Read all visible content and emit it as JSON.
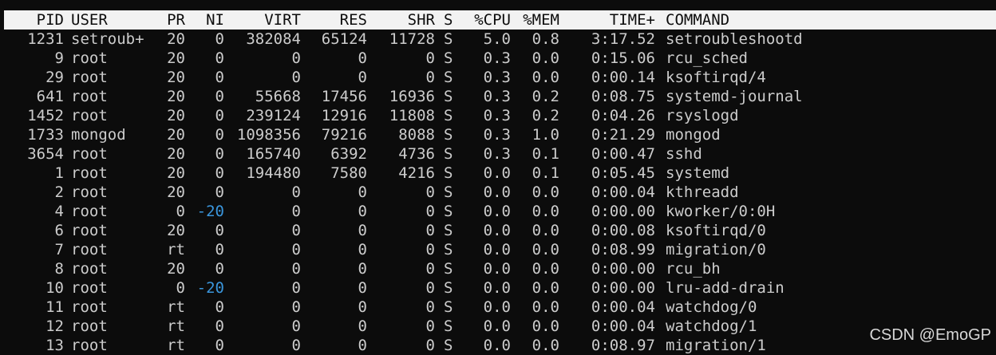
{
  "header": {
    "pid": "PID",
    "user": "USER",
    "pr": "PR",
    "ni": "NI",
    "virt": "VIRT",
    "res": "RES",
    "shr": "SHR",
    "s": "S",
    "cpu": "%CPU",
    "mem": "%MEM",
    "time": "TIME+",
    "command": "COMMAND"
  },
  "processes": [
    {
      "pid": "1231",
      "user": "setroub+",
      "pr": "20",
      "ni": "0",
      "virt": "382084",
      "res": "65124",
      "shr": "11728",
      "s": "S",
      "cpu": "5.0",
      "mem": "0.8",
      "time": "3:17.52",
      "command": "setroubleshootd"
    },
    {
      "pid": "9",
      "user": "root",
      "pr": "20",
      "ni": "0",
      "virt": "0",
      "res": "0",
      "shr": "0",
      "s": "S",
      "cpu": "0.3",
      "mem": "0.0",
      "time": "0:15.06",
      "command": "rcu_sched"
    },
    {
      "pid": "29",
      "user": "root",
      "pr": "20",
      "ni": "0",
      "virt": "0",
      "res": "0",
      "shr": "0",
      "s": "S",
      "cpu": "0.3",
      "mem": "0.0",
      "time": "0:00.14",
      "command": "ksoftirqd/4"
    },
    {
      "pid": "641",
      "user": "root",
      "pr": "20",
      "ni": "0",
      "virt": "55668",
      "res": "17456",
      "shr": "16936",
      "s": "S",
      "cpu": "0.3",
      "mem": "0.2",
      "time": "0:08.75",
      "command": "systemd-journal"
    },
    {
      "pid": "1452",
      "user": "root",
      "pr": "20",
      "ni": "0",
      "virt": "239124",
      "res": "12916",
      "shr": "11808",
      "s": "S",
      "cpu": "0.3",
      "mem": "0.2",
      "time": "0:04.26",
      "command": "rsyslogd"
    },
    {
      "pid": "1733",
      "user": "mongod",
      "pr": "20",
      "ni": "0",
      "virt": "1098356",
      "res": "79216",
      "shr": "8088",
      "s": "S",
      "cpu": "0.3",
      "mem": "1.0",
      "time": "0:21.29",
      "command": "mongod"
    },
    {
      "pid": "3654",
      "user": "root",
      "pr": "20",
      "ni": "0",
      "virt": "165740",
      "res": "6392",
      "shr": "4736",
      "s": "S",
      "cpu": "0.3",
      "mem": "0.1",
      "time": "0:00.47",
      "command": "sshd"
    },
    {
      "pid": "1",
      "user": "root",
      "pr": "20",
      "ni": "0",
      "virt": "194480",
      "res": "7580",
      "shr": "4216",
      "s": "S",
      "cpu": "0.0",
      "mem": "0.1",
      "time": "0:05.45",
      "command": "systemd"
    },
    {
      "pid": "2",
      "user": "root",
      "pr": "20",
      "ni": "0",
      "virt": "0",
      "res": "0",
      "shr": "0",
      "s": "S",
      "cpu": "0.0",
      "mem": "0.0",
      "time": "0:00.04",
      "command": "kthreadd"
    },
    {
      "pid": "4",
      "user": "root",
      "pr": "0",
      "ni": "-20",
      "virt": "0",
      "res": "0",
      "shr": "0",
      "s": "S",
      "cpu": "0.0",
      "mem": "0.0",
      "time": "0:00.00",
      "command": "kworker/0:0H"
    },
    {
      "pid": "6",
      "user": "root",
      "pr": "20",
      "ni": "0",
      "virt": "0",
      "res": "0",
      "shr": "0",
      "s": "S",
      "cpu": "0.0",
      "mem": "0.0",
      "time": "0:00.08",
      "command": "ksoftirqd/0"
    },
    {
      "pid": "7",
      "user": "root",
      "pr": "rt",
      "ni": "0",
      "virt": "0",
      "res": "0",
      "shr": "0",
      "s": "S",
      "cpu": "0.0",
      "mem": "0.0",
      "time": "0:08.99",
      "command": "migration/0"
    },
    {
      "pid": "8",
      "user": "root",
      "pr": "20",
      "ni": "0",
      "virt": "0",
      "res": "0",
      "shr": "0",
      "s": "S",
      "cpu": "0.0",
      "mem": "0.0",
      "time": "0:00.00",
      "command": "rcu_bh"
    },
    {
      "pid": "10",
      "user": "root",
      "pr": "0",
      "ni": "-20",
      "virt": "0",
      "res": "0",
      "shr": "0",
      "s": "S",
      "cpu": "0.0",
      "mem": "0.0",
      "time": "0:00.00",
      "command": "lru-add-drain"
    },
    {
      "pid": "11",
      "user": "root",
      "pr": "rt",
      "ni": "0",
      "virt": "0",
      "res": "0",
      "shr": "0",
      "s": "S",
      "cpu": "0.0",
      "mem": "0.0",
      "time": "0:00.04",
      "command": "watchdog/0"
    },
    {
      "pid": "12",
      "user": "root",
      "pr": "rt",
      "ni": "0",
      "virt": "0",
      "res": "0",
      "shr": "0",
      "s": "S",
      "cpu": "0.0",
      "mem": "0.0",
      "time": "0:00.04",
      "command": "watchdog/1"
    },
    {
      "pid": "13",
      "user": "root",
      "pr": "rt",
      "ni": "0",
      "virt": "0",
      "res": "0",
      "shr": "0",
      "s": "S",
      "cpu": "0.0",
      "mem": "0.0",
      "time": "0:08.97",
      "command": "migration/1"
    }
  ],
  "watermark": "CSDN @EmoGP",
  "colors": {
    "background": "#0c0c0c",
    "text": "#cccccc",
    "header_background": "#f2f2f2",
    "header_text": "#0c0c0c",
    "negative_nice": "#3a96dd"
  }
}
